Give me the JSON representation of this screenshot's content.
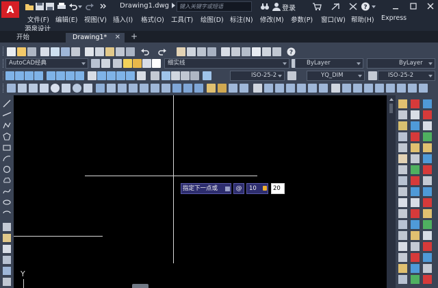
{
  "app": {
    "document_title": "Drawing1.dwg",
    "search_placeholder": "键入关键字或短语",
    "login_label": "登录",
    "logo_letter": "A"
  },
  "menu": {
    "items": [
      "文件(F)",
      "编辑(E)",
      "视图(V)",
      "插入(I)",
      "格式(O)",
      "工具(T)",
      "绘图(D)",
      "标注(N)",
      "修改(M)",
      "参数(P)",
      "窗口(W)",
      "帮助(H)",
      "Express"
    ],
    "second_row": "源泉设计"
  },
  "tabs": [
    {
      "label": "开始",
      "active": false
    },
    {
      "label": "Drawing1*",
      "active": true
    }
  ],
  "toolbars": {
    "workspace": "AutoCAD经典",
    "linetype": "细实线",
    "layer": "ByLayer",
    "lineweight": "ByLayer",
    "text_style": "ISO-25-2",
    "dim_style": "YQ_DIM",
    "table_style": "ISO-25-2"
  },
  "dynamic_input": {
    "prompt": "指定下一点或",
    "at_symbol": "@",
    "distance": "10",
    "angle": "20"
  },
  "ucs": {
    "y_label": "Y"
  },
  "colors": {
    "titlebar": "#222936",
    "toolbar_bg": "#3b4455",
    "canvas": "#000000",
    "accent_red": "#d61f26",
    "dyn_input_bg": "#2d2d6e"
  }
}
